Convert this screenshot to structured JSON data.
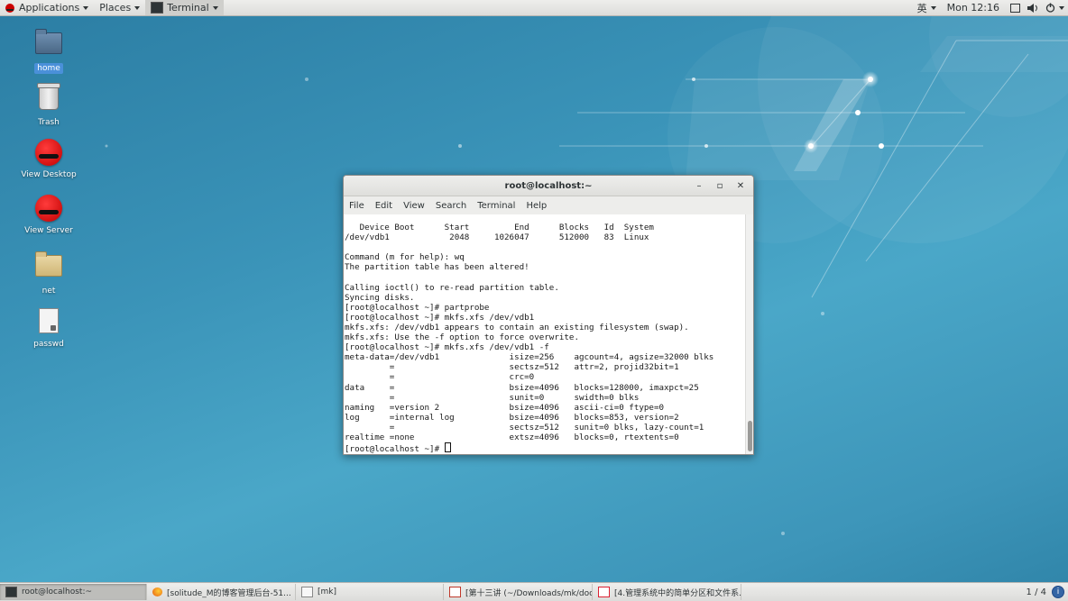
{
  "topbar": {
    "applications": "Applications",
    "places": "Places",
    "terminal": "Terminal",
    "input_method": "英",
    "clock": "Mon 12:16"
  },
  "desktop_icons": [
    {
      "label": "home"
    },
    {
      "label": "Trash"
    },
    {
      "label": "View Desktop"
    },
    {
      "label": "View Server"
    },
    {
      "label": "net"
    },
    {
      "label": "passwd"
    }
  ],
  "window": {
    "title": "root@localhost:~",
    "buttons": {
      "minimize": "–",
      "maximize": "▫",
      "close": "✕"
    },
    "menus": [
      "File",
      "Edit",
      "View",
      "Search",
      "Terminal",
      "Help"
    ],
    "terminal_lines": [
      "   Device Boot      Start         End      Blocks   Id  System",
      "/dev/vdb1            2048     1026047      512000   83  Linux",
      "",
      "Command (m for help): wq",
      "The partition table has been altered!",
      "",
      "Calling ioctl() to re-read partition table.",
      "Syncing disks.",
      "[root@localhost ~]# partprobe",
      "[root@localhost ~]# mkfs.xfs /dev/vdb1",
      "mkfs.xfs: /dev/vdb1 appears to contain an existing filesystem (swap).",
      "mkfs.xfs: Use the -f option to force overwrite.",
      "[root@localhost ~]# mkfs.xfs /dev/vdb1 -f",
      "meta-data=/dev/vdb1              isize=256    agcount=4, agsize=32000 blks",
      "         =                       sectsz=512   attr=2, projid32bit=1",
      "         =                       crc=0",
      "data     =                       bsize=4096   blocks=128000, imaxpct=25",
      "         =                       sunit=0      swidth=0 blks",
      "naming   =version 2              bsize=4096   ascii-ci=0 ftype=0",
      "log      =internal log           bsize=4096   blocks=853, version=2",
      "         =                       sectsz=512   sunit=0 blks, lazy-count=1",
      "realtime =none                   extsz=4096   blocks=0, rtextents=0"
    ],
    "prompt": "[root@localhost ~]# "
  },
  "taskbar": {
    "tasks": [
      {
        "label": "root@localhost:~",
        "icon": "terminal-icon"
      },
      {
        "label": "[solitude_M的博客管理后台-51...",
        "icon": "firefox-icon"
      },
      {
        "label": "[mk]",
        "icon": "file-manager-icon"
      },
      {
        "label": "[第十三讲 (~/Downloads/mk/doc/...",
        "icon": "document-icon"
      },
      {
        "label": "[4.管理系统中的简单分区和文件系...",
        "icon": "pdf-icon"
      }
    ],
    "pager": "1 / 4"
  }
}
